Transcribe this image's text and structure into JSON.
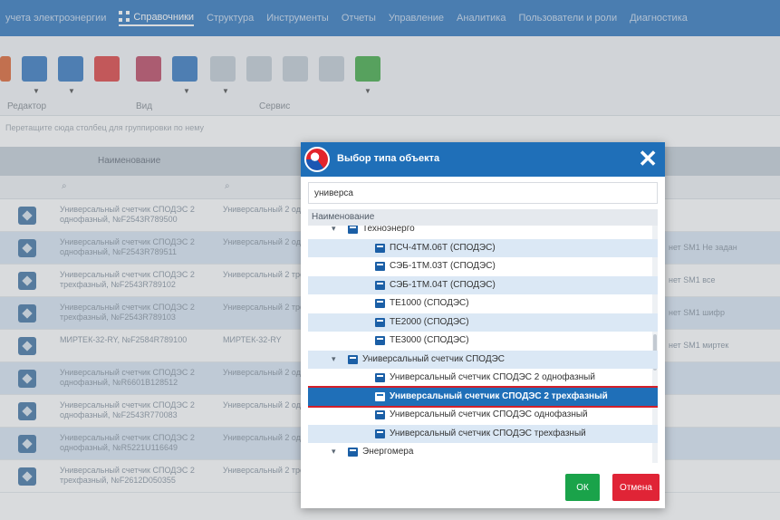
{
  "nav": {
    "items": [
      "учета электроэнергии",
      "Справочники",
      "Структура",
      "Инструменты",
      "Отчеты",
      "Управление",
      "Аналитика",
      "Пользователи и роли",
      "Диагностика"
    ],
    "active_index": 1
  },
  "toolbar": {
    "groups": [
      "Редактор",
      "Вид",
      "Сервис"
    ],
    "hint": "Перетащите сюда столбец для группировки по нему"
  },
  "grid": {
    "column_name": "Наименование",
    "filter_icon": "search-icon",
    "rows": [
      {
        "c1": "Универсальный счетчик СПОДЭС 2 однофазный, №F2543R789500",
        "c2": "Универсальный 2 однофазный",
        "c3": ""
      },
      {
        "c1": "Универсальный счетчик СПОДЭС 2 однофазный, №F2543R789511",
        "c2": "Универсальный 2 однофазный",
        "c3": "нет SM1 Не задан"
      },
      {
        "c1": "Универсальный счетчик СПОДЭС 2 трехфазный, №F2543R789102",
        "c2": "Универсальный 2 трехфазный",
        "c3": "нет SM1 все"
      },
      {
        "c1": "Универсальный счетчик СПОДЭС 2 трехфазный, №F2543R789103",
        "c2": "Универсальный 2 трехфазный",
        "c3": "нет SM1 шифр"
      },
      {
        "c1": "МИРТЕК-32-RY, №F2584R789100",
        "c2": "МИРТЕК-32-RY",
        "c3": "нет SM1 миртек"
      },
      {
        "c1": "Универсальный счетчик СПОДЭС 2 однофазный, №R6601B128512",
        "c2": "Универсальный 2 однофазный",
        "c3": ""
      },
      {
        "c1": "Универсальный счетчик СПОДЭС 2 однофазный, №F2543R770083",
        "c2": "Универсальный 2 однофазный",
        "c3": ""
      },
      {
        "c1": "Универсальный счетчик СПОДЭС 2 однофазный, №R5221U116649",
        "c2": "Универсальный 2 однофазный",
        "c3": ""
      },
      {
        "c1": "Универсальный счетчик СПОДЭС 2 трехфазный, №F2612D050355",
        "c2": "Универсальный 2 трехфазный",
        "c3": ""
      }
    ]
  },
  "modal": {
    "title": "Выбор типа объекта",
    "search_value": "универса",
    "tree_header": "Наименование",
    "tree": [
      {
        "label": "Техноэнерго",
        "level": 1,
        "expander": "▾",
        "type": "folder"
      },
      {
        "label": "ПСЧ-4ТМ.06Т (СПОДЭС)",
        "level": 2,
        "type": "leaf"
      },
      {
        "label": "СЭБ-1ТМ.03Т (СПОДЭС)",
        "level": 2,
        "type": "leaf"
      },
      {
        "label": "СЭБ-1ТМ.04Т (СПОДЭС)",
        "level": 2,
        "type": "leaf"
      },
      {
        "label": "ТЕ1000 (СПОДЭС)",
        "level": 2,
        "type": "leaf"
      },
      {
        "label": "ТЕ2000 (СПОДЭС)",
        "level": 2,
        "type": "leaf"
      },
      {
        "label": "ТЕ3000 (СПОДЭС)",
        "level": 2,
        "type": "leaf"
      },
      {
        "label": "Универсальный счетчик СПОДЭС",
        "level": 1,
        "expander": "▾",
        "type": "folder"
      },
      {
        "label": "Универсальный счетчик СПОДЭС 2 однофазный",
        "level": 2,
        "type": "leaf"
      },
      {
        "label": "Универсальный счетчик СПОДЭС 2 трехфазный",
        "level": 2,
        "type": "leaf",
        "selected": true
      },
      {
        "label": "Универсальный счетчик СПОДЭС однофазный",
        "level": 2,
        "type": "leaf"
      },
      {
        "label": "Универсальный счетчик СПОДЭС трехфазный",
        "level": 2,
        "type": "leaf"
      },
      {
        "label": "Энергомера",
        "level": 1,
        "expander": "▾",
        "type": "folder"
      }
    ],
    "ok_label": "ОК",
    "cancel_label": "Отмена"
  },
  "colors": {
    "nav_bg": "#3a7dc1",
    "modal_header": "#1f6fb8",
    "selection_outline": "#d2202a",
    "ok": "#1aa34a",
    "cancel": "#e02436"
  }
}
